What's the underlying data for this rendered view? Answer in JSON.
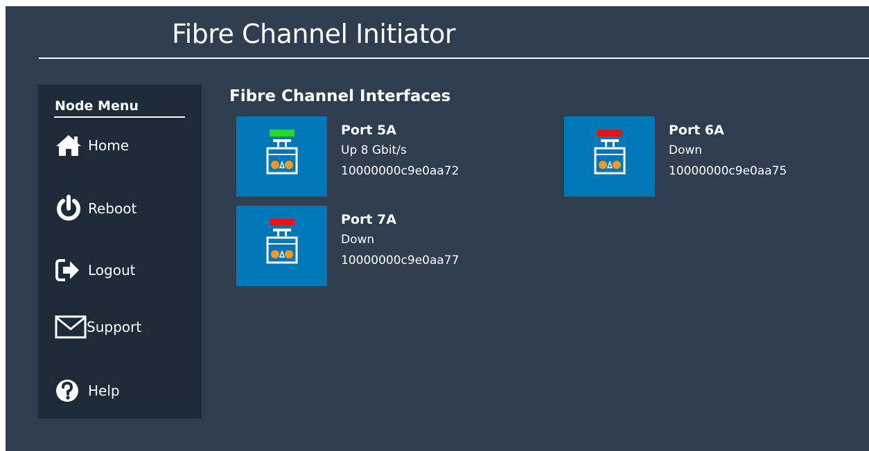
{
  "app": {
    "title": "Fibre Channel Initiator"
  },
  "sidebar": {
    "heading": "Node Menu",
    "items": [
      {
        "label": "Home",
        "icon": "home-icon"
      },
      {
        "label": "Reboot",
        "icon": "power-icon"
      },
      {
        "label": "Logout",
        "icon": "logout-icon"
      },
      {
        "label": "Support",
        "icon": "envelope-icon"
      },
      {
        "label": "Help",
        "icon": "help-icon"
      }
    ]
  },
  "main": {
    "section_title": "Fibre Channel Interfaces",
    "ports": [
      {
        "name": "Port 5A",
        "status": "Up 8 Gbit/s",
        "wwn": "10000000c9e0aa72",
        "link_up": true
      },
      {
        "name": "Port 6A",
        "status": "Down",
        "wwn": "10000000c9e0aa75",
        "link_up": false
      },
      {
        "name": "Port 7A",
        "status": "Down",
        "wwn": "10000000c9e0aa77",
        "link_up": false
      }
    ]
  },
  "colors": {
    "background": "#2e3d50",
    "sidebar": "#1d2a38",
    "tile": "#0077b6",
    "status_up": "#22dd22",
    "status_down": "#ee1111",
    "connector_dot": "#f39a1e"
  }
}
